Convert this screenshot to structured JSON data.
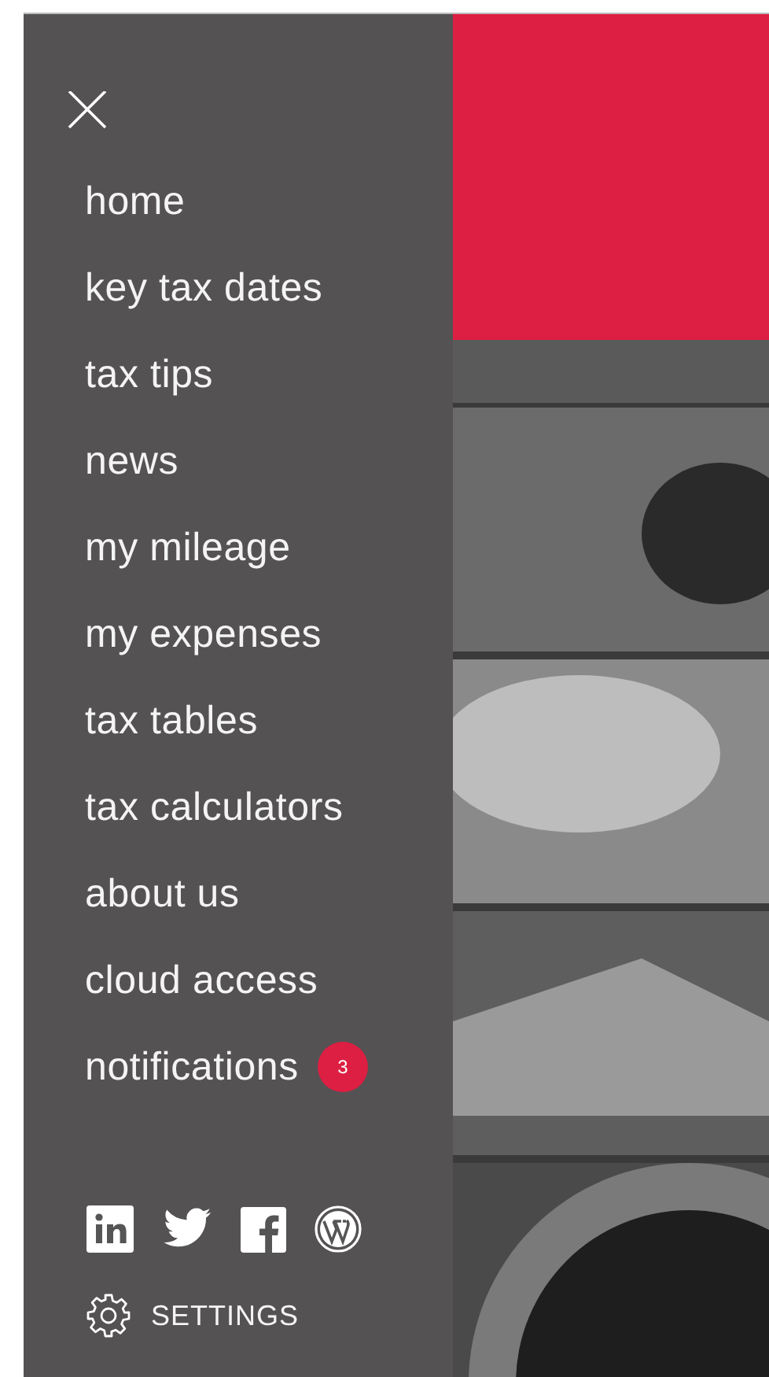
{
  "drawer": {
    "menu": [
      {
        "label": "home"
      },
      {
        "label": "key tax dates"
      },
      {
        "label": "tax tips"
      },
      {
        "label": "news"
      },
      {
        "label": "my mileage"
      },
      {
        "label": "my expenses"
      },
      {
        "label": "tax tables"
      },
      {
        "label": "tax calculators"
      },
      {
        "label": "about us"
      },
      {
        "label": "cloud access"
      },
      {
        "label": "notifications",
        "badge": "3"
      }
    ],
    "social": [
      {
        "kind": "linkedin"
      },
      {
        "kind": "twitter"
      },
      {
        "kind": "facebook"
      },
      {
        "kind": "wordpress"
      }
    ],
    "settings": {
      "label": "SETTINGS"
    }
  }
}
